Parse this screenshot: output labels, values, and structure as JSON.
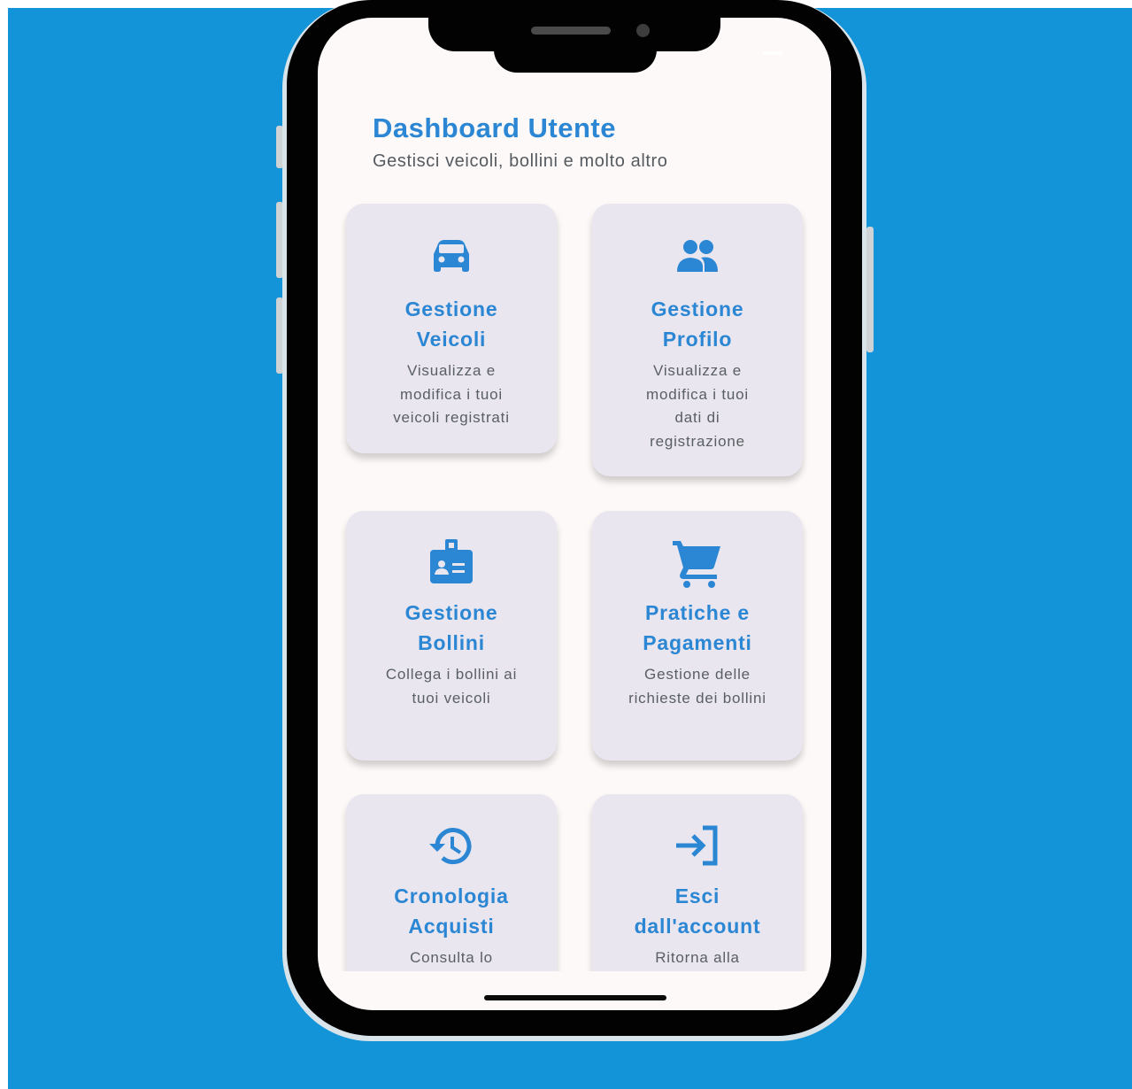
{
  "header": {
    "title": "Dashboard Utente",
    "subtitle": "Gestisci veicoli, bollini e molto altro"
  },
  "cards": [
    {
      "icon": "car-icon",
      "title": "Gestione Veicoli",
      "description": "Visualizza e modifica i tuoi veicoli registrati"
    },
    {
      "icon": "people-icon",
      "title": "Gestione Profilo",
      "description": "Visualizza e modifica i tuoi dati di registrazione"
    },
    {
      "icon": "badge-icon",
      "title": "Gestione Bollini",
      "description": "Collega i bollini ai tuoi veicoli"
    },
    {
      "icon": "cart-icon",
      "title": "Pratiche e Pagamenti",
      "description": "Gestione delle richieste dei bollini"
    },
    {
      "icon": "history-icon",
      "title": "Cronologia Acquisti",
      "description": "Consulta lo"
    },
    {
      "icon": "logout-icon",
      "title": "Esci dall'account",
      "description": "Ritorna alla"
    }
  ],
  "colors": {
    "background": "#1394d8",
    "accent": "#2b86d4",
    "card": "#e9e6ef",
    "screen": "#fdf9f8"
  }
}
